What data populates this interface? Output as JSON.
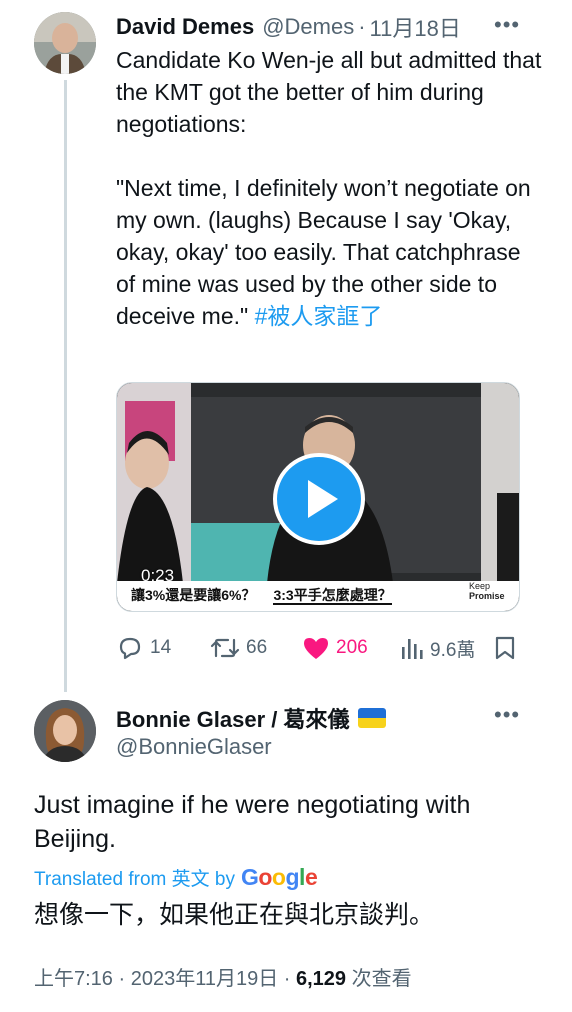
{
  "tweet1": {
    "author_name": "David Demes",
    "handle": "@Demes",
    "separator": "·",
    "date": "11月18日",
    "lines": [
      "Candidate Ko Wen-je all but admitted that the KMT got the better of him during negotiations:",
      "\"Next time, I definitely won’t negotiate on my own. (laughs) Because I say 'Okay, okay, okay' too easily. That catchphrase of mine was used by the other side to deceive me.\""
    ],
    "hashtag": "#被人家誆了",
    "media": {
      "duration": "0:23",
      "caption_1": "讓3%還是要讓6%？",
      "caption_2": "3:3平手怎麼處理？",
      "brand_line_1": "Keep",
      "brand_line_2": "Promise"
    },
    "stats": {
      "replies": "14",
      "retweets": "66",
      "likes": "206",
      "views": "9.6萬"
    }
  },
  "tweet2": {
    "author_name": "Bonnie Glaser / 葛來儀",
    "handle": "@BonnieGlaser",
    "text": "Just imagine if he were negotiating with Beijing.",
    "translated_label": "Translated from 英文 by",
    "translation": "想像一下，如果他正在與北京談判。",
    "time_date": "上午7:16 · 2023年11月19日 · ",
    "views_count": "6,129",
    "views_label": " 次查看"
  },
  "colors": {
    "accent": "#1d9bf0",
    "like": "#f91880",
    "muted": "#536471"
  },
  "icons": [
    "more-icon",
    "reply-icon",
    "retweet-icon",
    "heart-icon",
    "views-icon",
    "bookmark-icon",
    "play-icon",
    "ukraine-flag-icon",
    "google-logo"
  ]
}
